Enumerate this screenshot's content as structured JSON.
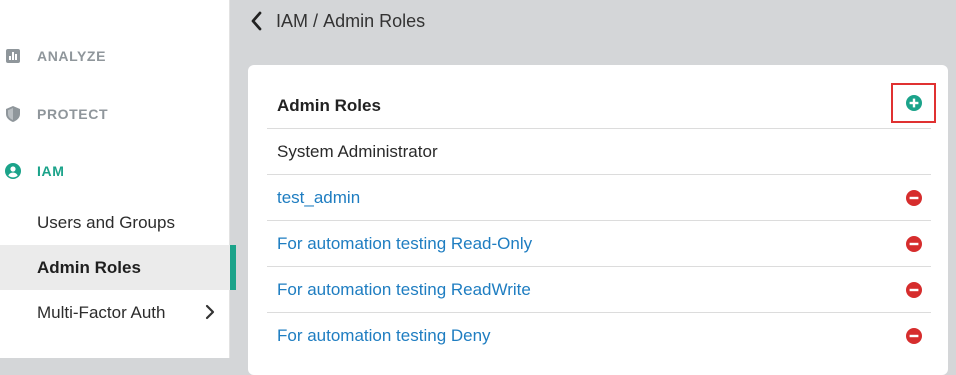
{
  "sidebar": {
    "sections": [
      {
        "label": "ANALYZE",
        "icon": "bar-chart-icon"
      },
      {
        "label": "PROTECT",
        "icon": "shield-icon"
      },
      {
        "label": "IAM",
        "icon": "user-circle-icon"
      }
    ],
    "iam_items": [
      {
        "label": "Users and Groups"
      },
      {
        "label": "Admin Roles"
      },
      {
        "label": "Multi-Factor Auth"
      }
    ]
  },
  "header": {
    "crumb_parent": "IAM",
    "crumb_sep": "/",
    "crumb_current": "Admin Roles"
  },
  "card": {
    "title": "Admin Roles",
    "roles": [
      {
        "name": "System Administrator"
      },
      {
        "name": "test_admin"
      },
      {
        "name": "For automation testing Read-Only"
      },
      {
        "name": "For automation testing ReadWrite"
      },
      {
        "name": "For automation testing Deny"
      }
    ]
  },
  "colors": {
    "accent": "#1ba38a",
    "link": "#1e7dc1",
    "delete": "#d62d2d",
    "highlight": "#e03131"
  }
}
